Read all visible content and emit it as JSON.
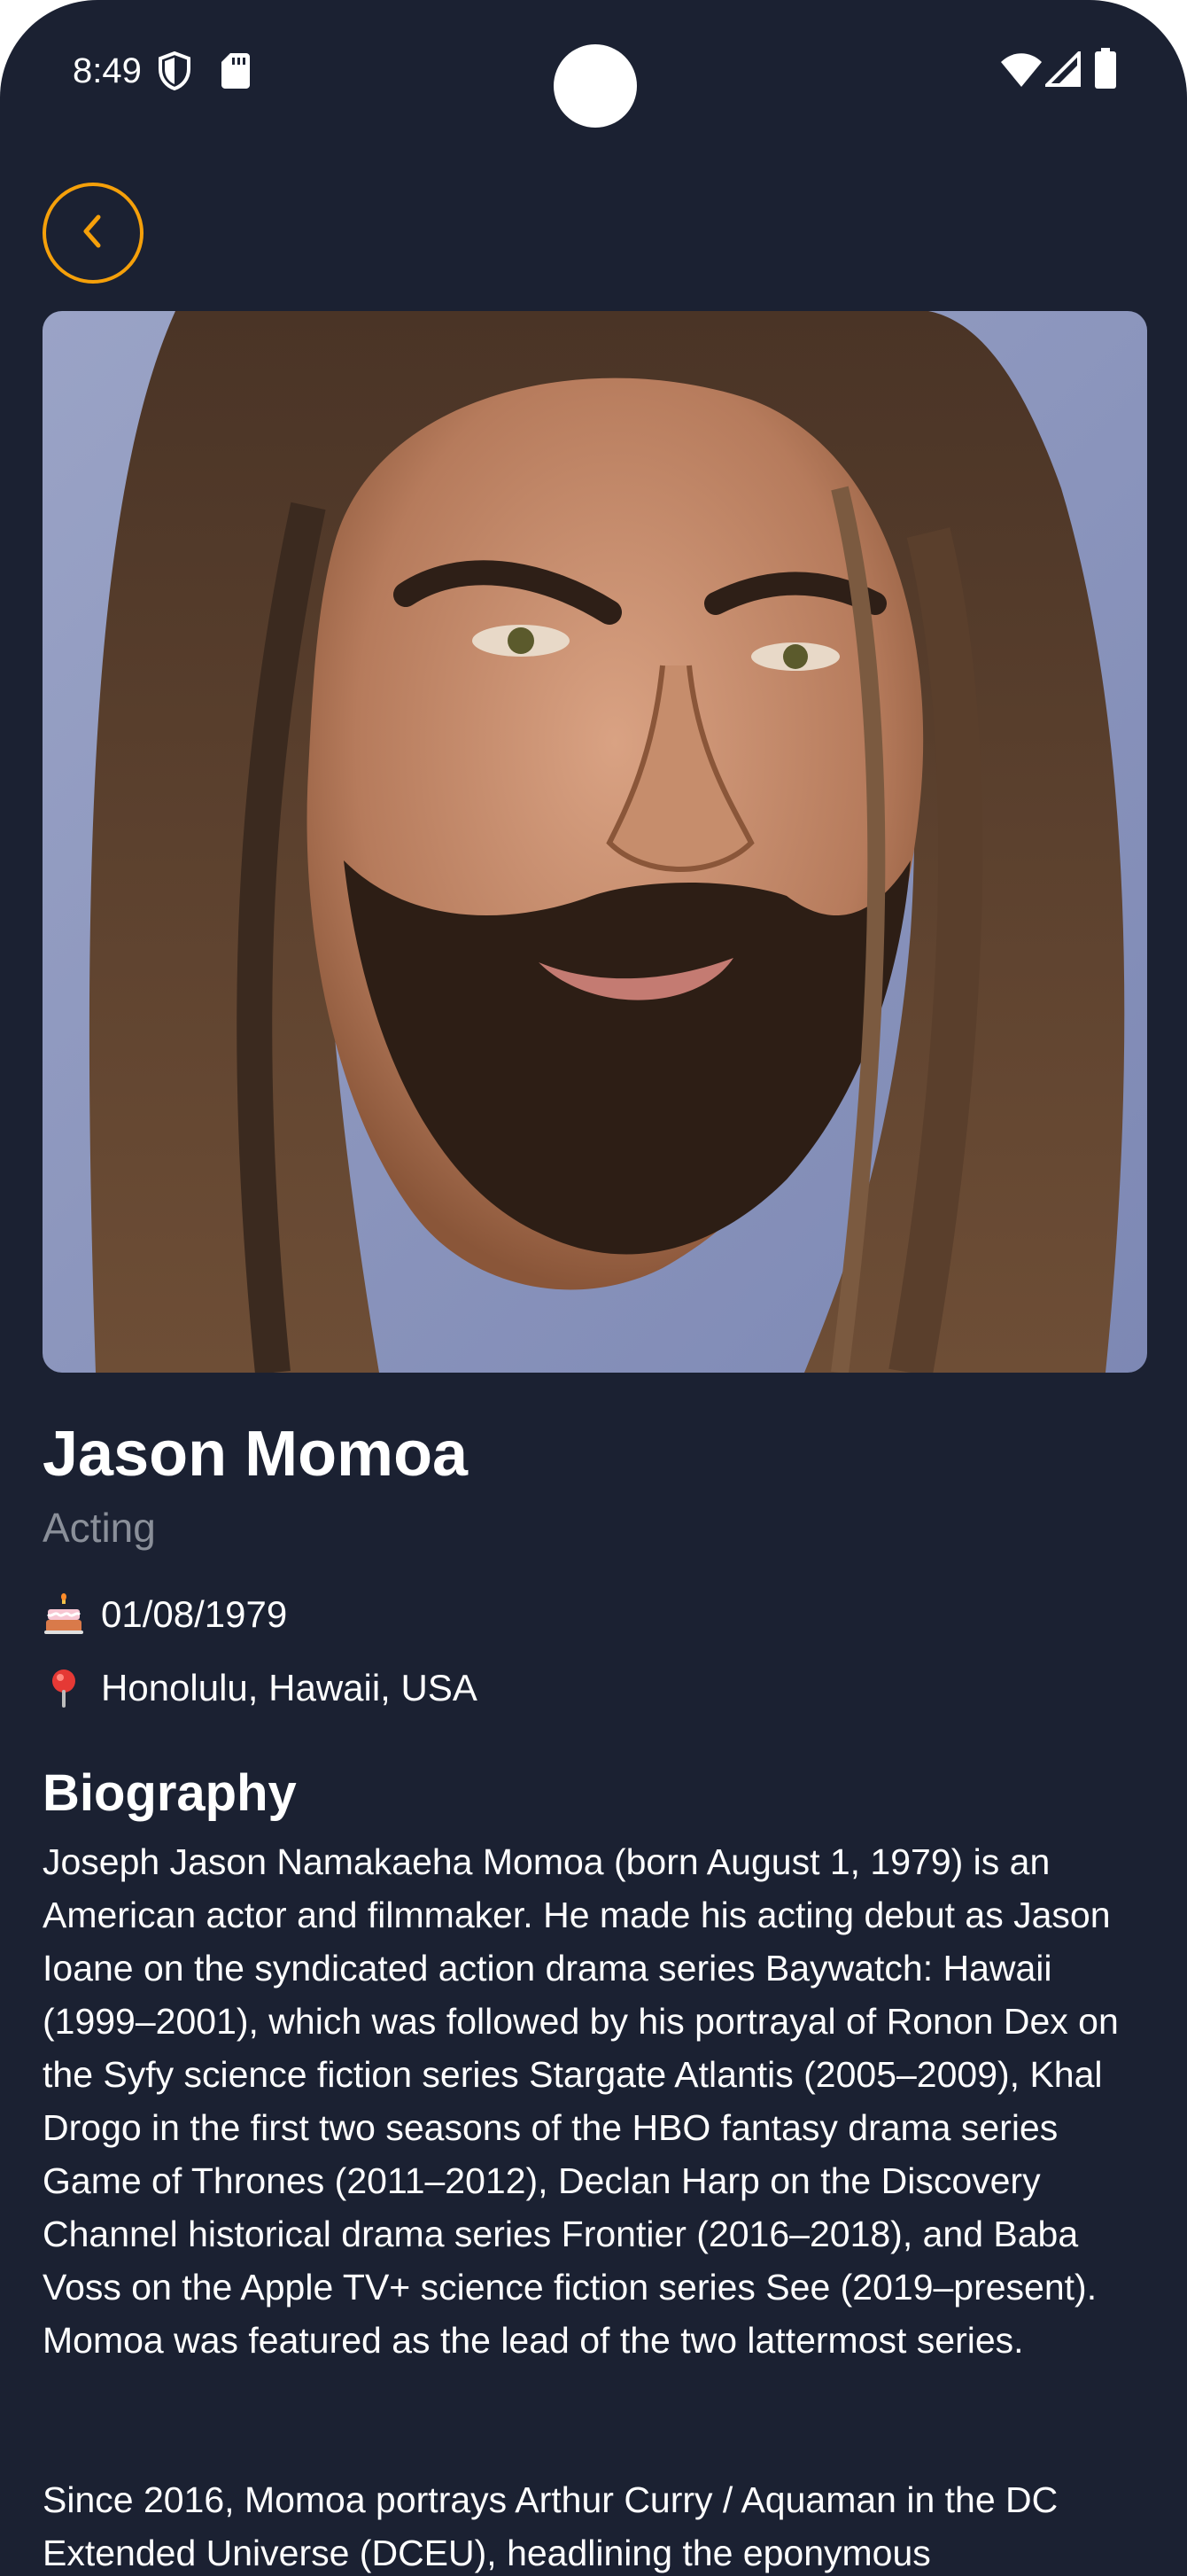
{
  "status_bar": {
    "time": "8:49",
    "icons": [
      "shield-icon",
      "sd-card-icon",
      "wifi-icon",
      "signal-icon",
      "battery-icon"
    ]
  },
  "colors": {
    "background": "#1b2132",
    "accent": "#f5a00a",
    "muted_text": "#8a8f99"
  },
  "header": {
    "back_icon": "chevron-left-icon"
  },
  "person": {
    "photo_icon": "person-portrait",
    "name": "Jason Momoa",
    "department": "Acting",
    "birthday_icon": "birthday-cake-icon",
    "birthday": "01/08/1979",
    "place_icon": "location-pin-icon",
    "place_of_birth": "Honolulu, Hawaii, USA"
  },
  "biography": {
    "title": "Biography",
    "paragraph_1": "Joseph Jason Namakaeha Momoa (born August 1, 1979) is an American actor and filmmaker. He made his acting debut as Jason Ioane on the syndicated action drama series Baywatch: Hawaii (1999–2001), which was followed by his portrayal of Ronon Dex on the Syfy science fiction series Stargate Atlantis (2005–2009), Khal Drogo in the first two seasons of the HBO fantasy drama series Game of Thrones (2011–2012), Declan Harp on the Discovery Channel historical drama series Frontier (2016–2018), and Baba Voss on the Apple TV+ science fiction series See (2019–present). Momoa was featured as the lead of the two lattermost series.",
    "paragraph_2": "Since 2016, Momoa portrays Arthur Curry / Aquaman in the DC Extended Universe (DCEU), headlining the eponymous"
  }
}
